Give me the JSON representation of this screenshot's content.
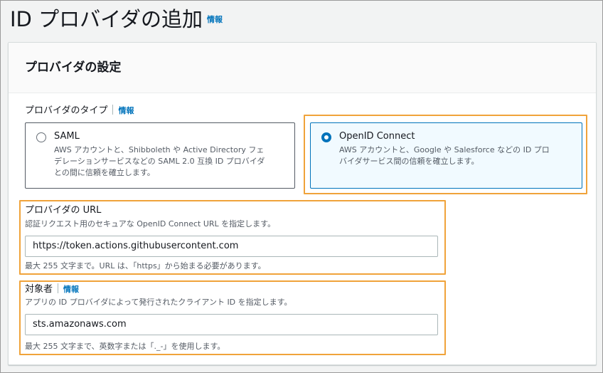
{
  "header": {
    "title": "ID プロバイダの追加",
    "info": "情報"
  },
  "panel": {
    "title": "プロバイダの設定",
    "provider_type": {
      "label": "プロバイダのタイプ",
      "info": "情報",
      "options": [
        {
          "label": "SAML",
          "selected": false,
          "description_lines": [
            "AWS アカウントと、Shibboleth や Active Directory フェ",
            "デレーションサービスなどの SAML 2.0 互換 ID プロバイダ",
            "との間に信頼を確立します。"
          ]
        },
        {
          "label": "OpenID Connect",
          "selected": true,
          "description_lines": [
            "AWS アカウントと、Google や Salesforce などの ID プロ",
            "バイダサービス間の信頼を確立します。"
          ]
        }
      ]
    },
    "provider_url": {
      "label": "プロバイダの URL",
      "description": "認証リクエスト用のセキュアな OpenID Connect URL を指定します。",
      "value": "https://token.actions.githubusercontent.com",
      "constraint": "最大 255 文字まで。URL は、「https」から始まる必要があります。"
    },
    "audience": {
      "label": "対象者",
      "info": "情報",
      "description": "アプリの ID プロバイダによって発行されたクライアント ID を指定します。",
      "value": "sts.amazonaws.com",
      "constraint": "最大 255 文字まで、英数字または「._-」を使用します。"
    }
  },
  "colors": {
    "highlight": "#f0a33a",
    "accent": "#0073bb"
  }
}
